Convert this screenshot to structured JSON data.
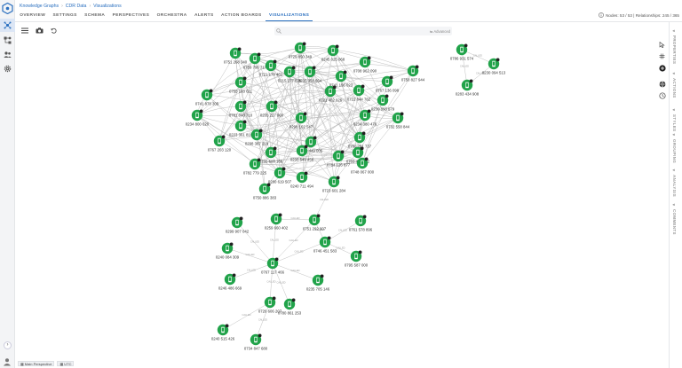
{
  "breadcrumb": [
    "Knowledge Graphs",
    "CDR Data",
    "Visualizations"
  ],
  "tabs": [
    {
      "label": "OVERVIEW",
      "active": false
    },
    {
      "label": "SETTINGS",
      "active": false
    },
    {
      "label": "SCHEMA",
      "active": false
    },
    {
      "label": "PERSPECTIVES",
      "active": false
    },
    {
      "label": "ORCHESTRA",
      "active": false
    },
    {
      "label": "ALERTS",
      "active": false
    },
    {
      "label": "ACTION BOARDS",
      "active": false
    },
    {
      "label": "VISUALIZATIONS",
      "active": true
    }
  ],
  "stats": {
    "text": "Nodes: 53 / 53 | Relationships: 245 / 365"
  },
  "search": {
    "placeholder": "",
    "advanced": "Advanced"
  },
  "right_rail": [
    "PROPERTIES",
    "ACTIONS",
    "STYLES",
    "GROUPING",
    "ANALYSIS",
    "COMMENTS"
  ],
  "edge_label": "CALLED",
  "bottom": {
    "perspective": "Main Perspective",
    "timezone": "UTC"
  },
  "colors": {
    "accent": "#2a6fbf",
    "node": "#21a34a",
    "edge": "#b9b9b9"
  },
  "icons": {
    "node": "phone-icon",
    "badge": "count-badge"
  },
  "graph": {
    "nodes": [
      {
        "id": 0,
        "label": "0751 268 340"
      },
      {
        "id": 1,
        "label": "0759 796 717"
      },
      {
        "id": 2,
        "label": "0721 178 461"
      },
      {
        "id": 3,
        "label": "0729 850 349"
      },
      {
        "id": 4,
        "label": "0245 025 068"
      },
      {
        "id": 5,
        "label": "0708 962 090"
      },
      {
        "id": 6,
        "label": "0215 277 025"
      },
      {
        "id": 7,
        "label": "0235 358 654"
      },
      {
        "id": 8,
        "label": "0741 156 023"
      },
      {
        "id": 9,
        "label": "0750 827 944"
      },
      {
        "id": 10,
        "label": "0755 183 611"
      },
      {
        "id": 11,
        "label": "0741 878 305"
      },
      {
        "id": 12,
        "label": "0721 402 926"
      },
      {
        "id": 13,
        "label": "0767 136 098"
      },
      {
        "id": 14,
        "label": "0781 048 710"
      },
      {
        "id": 15,
        "label": "0205 227 900"
      },
      {
        "id": 16,
        "label": "0722 844 762"
      },
      {
        "id": 17,
        "label": "0234 800 620"
      },
      {
        "id": 18,
        "label": "0223 361 818"
      },
      {
        "id": 19,
        "label": "0298 102 547"
      },
      {
        "id": 20,
        "label": "0230 898 579"
      },
      {
        "id": 21,
        "label": "0234 380 476"
      },
      {
        "id": 22,
        "label": "0732 558 844"
      },
      {
        "id": 23,
        "label": "0767 203 120"
      },
      {
        "id": 24,
        "label": "0298 387 218"
      },
      {
        "id": 25,
        "label": "0227 449 005"
      },
      {
        "id": 26,
        "label": "0786 281 737"
      },
      {
        "id": 27,
        "label": "0703 451 012"
      },
      {
        "id": 28,
        "label": "0705 608 169"
      },
      {
        "id": 29,
        "label": "0233 549 458"
      },
      {
        "id": 30,
        "label": "0784 126 877"
      },
      {
        "id": 31,
        "label": "0782 779 225"
      },
      {
        "id": 32,
        "label": "0748 067 000"
      },
      {
        "id": 33,
        "label": "0240 711 494"
      },
      {
        "id": 34,
        "label": "0280 619 507"
      },
      {
        "id": 35,
        "label": "0723 601 284"
      },
      {
        "id": 36,
        "label": "0750 886 383"
      },
      {
        "id": 37,
        "label": "0786 931 574"
      },
      {
        "id": 38,
        "label": "0230 094 513"
      },
      {
        "id": 39,
        "label": "0283 434 908"
      },
      {
        "id": 40,
        "label": "0259 660 402"
      },
      {
        "id": 41,
        "label": "0299 907 042"
      },
      {
        "id": 42,
        "label": "0751 292 907"
      },
      {
        "id": 43,
        "label": "0761 578 896"
      },
      {
        "id": 44,
        "label": "0746 451 583"
      },
      {
        "id": 45,
        "label": "0240 084 309"
      },
      {
        "id": 46,
        "label": "0795 587 000"
      },
      {
        "id": 47,
        "label": "0767 117 466"
      },
      {
        "id": 48,
        "label": "0246 486 669"
      },
      {
        "id": 49,
        "label": "0235 705 146"
      },
      {
        "id": 50,
        "label": "0726 606 207"
      },
      {
        "id": 51,
        "label": "0780 861 253"
      },
      {
        "id": 52,
        "label": "0240 515 426"
      },
      {
        "id": 53,
        "label": "0734 847 680"
      }
    ],
    "edges": [
      [
        37,
        38
      ],
      [
        37,
        39
      ],
      [
        38,
        39
      ],
      [
        40,
        42
      ],
      [
        41,
        47
      ],
      [
        42,
        44
      ],
      [
        43,
        44
      ],
      [
        44,
        46
      ],
      [
        44,
        47
      ],
      [
        45,
        47
      ],
      [
        47,
        48
      ],
      [
        47,
        49
      ],
      [
        47,
        50
      ],
      [
        47,
        51
      ],
      [
        50,
        52
      ],
      [
        50,
        53
      ],
      [
        42,
        35
      ],
      [
        42,
        47
      ],
      [
        40,
        47
      ]
    ]
  }
}
